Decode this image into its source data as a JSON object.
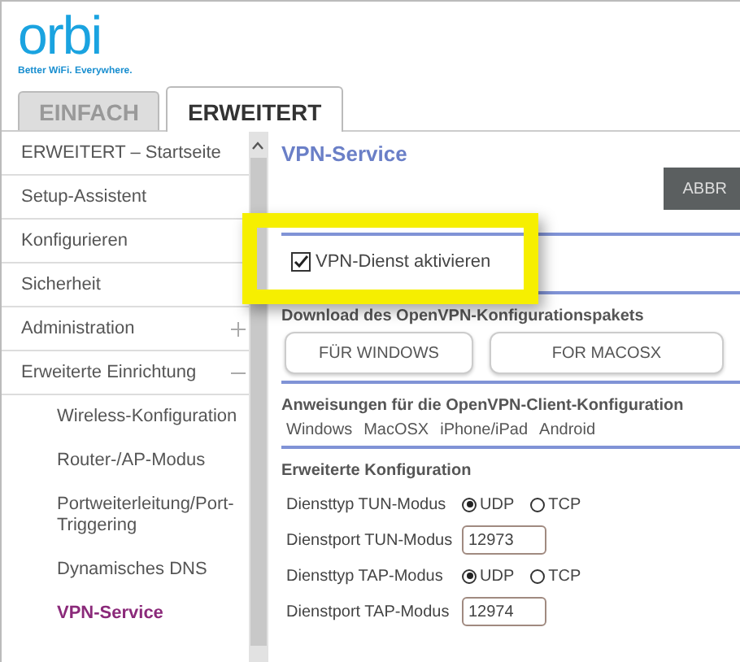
{
  "logo": {
    "brand": "orbi",
    "tagline": "Better WiFi. Everywhere."
  },
  "tabs": [
    {
      "label": "EINFACH",
      "selected": false
    },
    {
      "label": "ERWEITERT",
      "selected": true
    }
  ],
  "sidebar": {
    "items": [
      {
        "label": "ERWEITERT – Startseite"
      },
      {
        "label": "Setup-Assistent"
      },
      {
        "label": "Konfigurieren"
      },
      {
        "label": "Sicherheit"
      },
      {
        "label": "Administration",
        "expanded": false
      },
      {
        "label": "Erweiterte Einrichtung",
        "expanded": true,
        "children": [
          {
            "label": "Wireless-Konfiguration",
            "selected": false
          },
          {
            "label": "Router-/AP-Modus",
            "selected": false
          },
          {
            "label": "Portweiterleitung/Port-Triggering",
            "selected": false
          },
          {
            "label": "Dynamisches DNS",
            "selected": false
          },
          {
            "label": "VPN-Service",
            "selected": true
          }
        ]
      }
    ]
  },
  "content": {
    "title": "VPN-Service",
    "cancel_button": "ABBR",
    "enable": {
      "label": "VPN-Dienst aktivieren",
      "checked": true
    },
    "download": {
      "heading": "Download des OpenVPN-Konfigurationspakets",
      "buttons": [
        "FÜR WINDOWS",
        "FOR MACOSX"
      ]
    },
    "instructions": {
      "heading": "Anweisungen für die OpenVPN-Client-Konfiguration",
      "links": [
        "Windows",
        "MacOSX",
        "iPhone/iPad",
        "Android"
      ]
    },
    "advanced": {
      "heading": "Erweiterte Konfiguration",
      "rows": [
        {
          "kind": "radio",
          "label": "Diensttyp TUN-Modus",
          "options": [
            {
              "label": "UDP",
              "selected": true
            },
            {
              "label": "TCP",
              "selected": false
            }
          ]
        },
        {
          "kind": "input",
          "label": "Dienstport TUN-Modus",
          "value": "12973"
        },
        {
          "kind": "radio",
          "label": "Diensttyp TAP-Modus",
          "options": [
            {
              "label": "UDP",
              "selected": true
            },
            {
              "label": "TCP",
              "selected": false
            }
          ]
        },
        {
          "kind": "input",
          "label": "Dienstport TAP-Modus",
          "value": "12974"
        }
      ]
    }
  }
}
